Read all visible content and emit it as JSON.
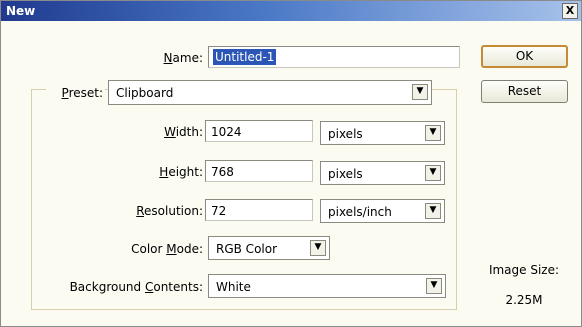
{
  "window": {
    "title": "New",
    "close_label": "X"
  },
  "form": {
    "name": {
      "label_pre": "",
      "label_accel": "N",
      "label_post": "ame:",
      "value": "Untitled-1"
    },
    "preset": {
      "label_pre": "",
      "label_accel": "P",
      "label_post": "reset:",
      "value": "Clipboard"
    },
    "width": {
      "label_pre": "",
      "label_accel": "W",
      "label_post": "idth:",
      "value": "1024",
      "unit": "pixels"
    },
    "height": {
      "label_pre": "",
      "label_accel": "H",
      "label_post": "eight:",
      "value": "768",
      "unit": "pixels"
    },
    "resolution": {
      "label_pre": "",
      "label_accel": "R",
      "label_post": "esolution:",
      "value": "72",
      "unit": "pixels/inch"
    },
    "color_mode": {
      "label_pre": "Color ",
      "label_accel": "M",
      "label_post": "ode:",
      "value": "RGB Color"
    },
    "background": {
      "label_pre": "Background ",
      "label_accel": "C",
      "label_post": "ontents:",
      "value": "White"
    }
  },
  "buttons": {
    "ok": "OK",
    "reset": "Reset"
  },
  "image_size": {
    "label": "Image Size:",
    "value": "2.25M"
  },
  "icons": {
    "dropdown": "chevron-down-icon"
  }
}
